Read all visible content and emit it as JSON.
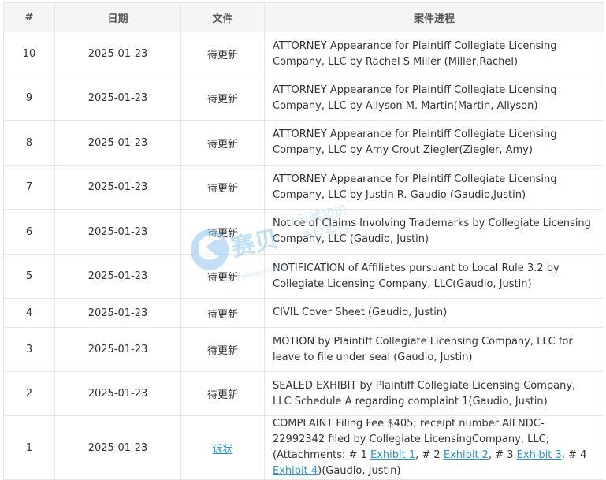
{
  "header": {
    "num": "#",
    "date": "日期",
    "file": "文件",
    "progress": "案件进程"
  },
  "rows": [
    {
      "num": "10",
      "date": "2025-01-23",
      "file": "待更新",
      "desc": "ATTORNEY Appearance for Plaintiff Collegiate Licensing Company, LLC by Rachel S Miller (Miller,Rachel)"
    },
    {
      "num": "9",
      "date": "2025-01-23",
      "file": "待更新",
      "desc": "ATTORNEY Appearance for Plaintiff Collegiate Licensing Company, LLC by Allyson M. Martin(Martin, Allyson)"
    },
    {
      "num": "8",
      "date": "2025-01-23",
      "file": "待更新",
      "desc": "ATTORNEY Appearance for Plaintiff Collegiate Licensing Company, LLC by Amy Crout Ziegler(Ziegler, Amy)"
    },
    {
      "num": "7",
      "date": "2025-01-23",
      "file": "待更新",
      "desc": "ATTORNEY Appearance for Plaintiff Collegiate Licensing Company, LLC by Justin R. Gaudio (Gaudio,Justin)"
    },
    {
      "num": "6",
      "date": "2025-01-23",
      "file": "待更新",
      "desc": "Notice of Claims Involving Trademarks by Collegiate Licensing Company, LLC (Gaudio, Justin)"
    },
    {
      "num": "5",
      "date": "2025-01-23",
      "file": "待更新",
      "desc": "NOTIFICATION of Affiliates pursuant to Local Rule 3.2 by Collegiate Licensing Company, LLC(Gaudio, Justin)"
    },
    {
      "num": "4",
      "date": "2025-01-23",
      "file": "待更新",
      "desc": "CIVIL Cover Sheet (Gaudio, Justin)"
    },
    {
      "num": "3",
      "date": "2025-01-23",
      "file": "待更新",
      "desc": "MOTION by Plaintiff Collegiate Licensing Company, LLC for leave to file under seal (Gaudio, Justin)"
    },
    {
      "num": "2",
      "date": "2025-01-23",
      "file": "待更新",
      "desc": "SEALED EXHIBIT by Plaintiff Collegiate Licensing Company, LLC Schedule A regarding complaint 1(Gaudio, Justin)"
    }
  ],
  "last_row": {
    "num": "1",
    "date": "2025-01-23",
    "file_link": "诉状",
    "desc_prefix": "COMPLAINT Filing Fee $405; receipt number AILNDC-22992342 filed by Collegiate LicensingCompany, LLC; (Attachments: # 1 ",
    "exhibit1": "Exhibit 1",
    "sep2": ", # 2 ",
    "exhibit2": "Exhibit 2",
    "sep3": ", # 3 ",
    "exhibit3": "Exhibit 3",
    "sep4": ", # 4 ",
    "exhibit4": "Exhibit 4",
    "desc_suffix": ")(Gaudio, Justin)"
  },
  "watermark": {
    "brand": "赛贝",
    "line1": "云端知识",
    "line2": "产权平台",
    "url": "www.saibeiip.com"
  }
}
